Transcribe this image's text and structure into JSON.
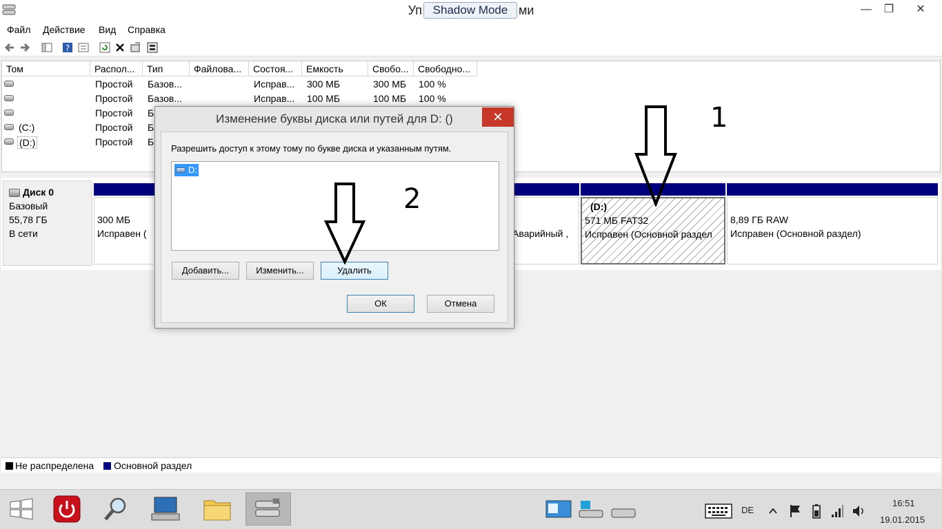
{
  "window": {
    "title_left": "Уп",
    "title_right": "ми",
    "shadow_badge": "Shadow Mode",
    "minimize": "—",
    "maximize": "❐",
    "close": "✕"
  },
  "menu": [
    "Файл",
    "Действие",
    "Вид",
    "Справка"
  ],
  "toolbar": {
    "icons": [
      "back-arrow-icon",
      "forward-arrow-icon",
      "console-tree-icon",
      "help-icon",
      "properties-icon",
      "refresh-icon",
      "delete-icon",
      "settings-icon",
      "disk-props-icon"
    ]
  },
  "volumes": {
    "headers": [
      "Том",
      "Распол...",
      "Тип",
      "Файлова...",
      "Состоя...",
      "Емкость",
      "Свобо...",
      "Свободно..."
    ],
    "rows": [
      {
        "name": "",
        "layout": "Простой",
        "type": "Базов...",
        "fs": "",
        "status": "Исправ...",
        "capacity": "300 МБ",
        "free": "300 МБ",
        "free_pct": "100 %"
      },
      {
        "name": "",
        "layout": "Простой",
        "type": "Базов...",
        "fs": "",
        "status": "Исправ...",
        "capacity": "100 МБ",
        "free": "100 МБ",
        "free_pct": "100 %"
      },
      {
        "name": "",
        "layout": "Простой",
        "type": "Ба",
        "fs": "",
        "status": "",
        "capacity": "",
        "free": "",
        "free_pct": ""
      },
      {
        "name": "(C:)",
        "layout": "Простой",
        "type": "Ба",
        "fs": "",
        "status": "",
        "capacity": "",
        "free": "",
        "free_pct": ""
      },
      {
        "name": "(D:)",
        "layout": "Простой",
        "type": "Ба",
        "fs": "",
        "status": "",
        "capacity": "",
        "free": "",
        "free_pct": ""
      }
    ]
  },
  "disk": {
    "title": "Диск 0",
    "type": "Базовый",
    "size": "55,78 ГБ",
    "status": "В сети",
    "partitions": [
      {
        "line1": "",
        "line2": "300 МБ",
        "line3": "Исправен ("
      },
      {
        "line1": "",
        "line2": "",
        "line3": "Аварийный ,"
      },
      {
        "line1": "(D:)",
        "line2": "571 МБ FAT32",
        "line3": "Исправен (Основной раздел"
      },
      {
        "line1": "",
        "line2": "8,89 ГБ RAW",
        "line3": "Исправен (Основной раздел)"
      }
    ]
  },
  "legend": {
    "unallocated": "Не распределена",
    "primary": "Основной раздел",
    "unallocated_color": "#000000",
    "primary_color": "#00007f"
  },
  "annotations": {
    "one": "1",
    "two": "2"
  },
  "dialog": {
    "title": "Изменение буквы диска или путей для D: ()",
    "close": "✕",
    "description": "Разрешить доступ к этому тому по букве диска и указанным путям.",
    "list_item": "D:",
    "add_button": "Добавить...",
    "change_button": "Изменить...",
    "remove_button": "Удалить",
    "ok_button": "ОК",
    "cancel_button": "Отмена"
  },
  "taskbar": {
    "apps": [
      "start-icon",
      "shutdown-icon",
      "search-icon",
      "computer-icon",
      "file-explorer-icon",
      "disk-management-icon"
    ],
    "language": "DE",
    "time": "16:51",
    "date": "19.01.2015"
  }
}
